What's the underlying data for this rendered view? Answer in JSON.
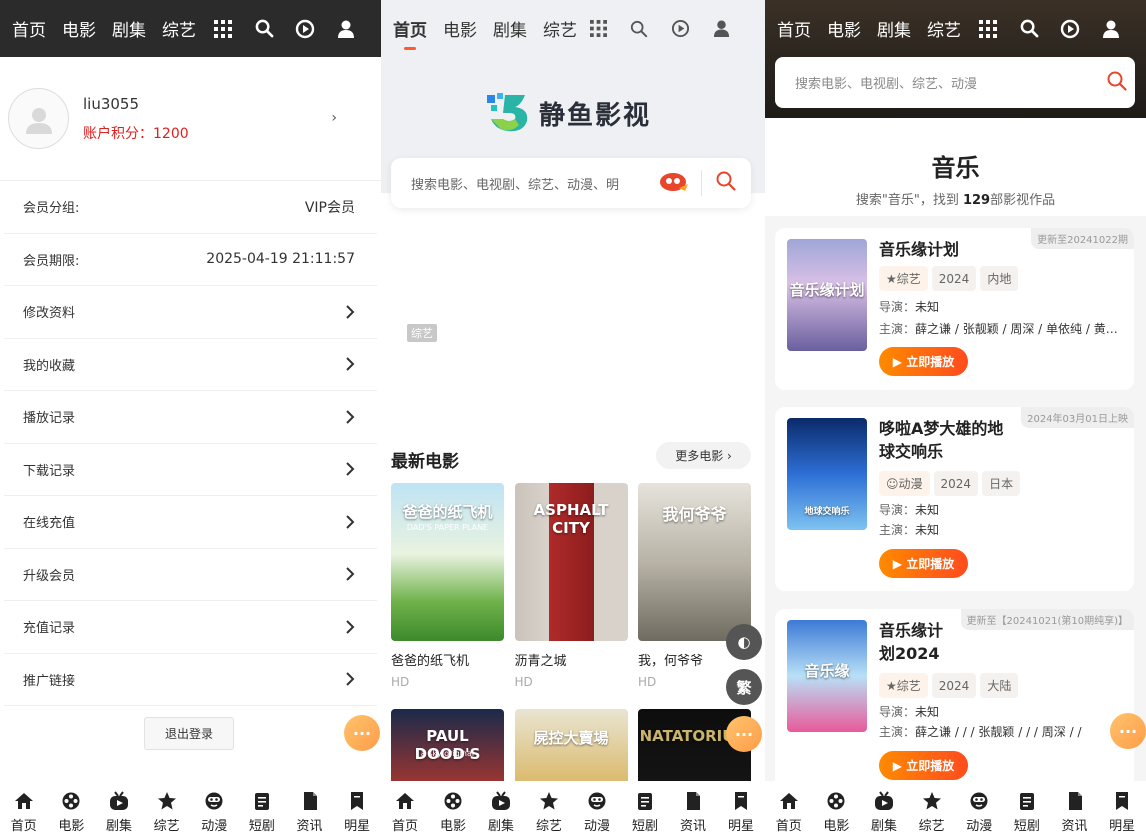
{
  "nav": {
    "home": "首页",
    "movie": "电影",
    "series": "剧集",
    "variety": "综艺"
  },
  "bottom_nav": [
    {
      "label": "首页",
      "icon": "home-icon"
    },
    {
      "label": "电影",
      "icon": "film-reel-icon"
    },
    {
      "label": "剧集",
      "icon": "tv-icon"
    },
    {
      "label": "综艺",
      "icon": "star-icon"
    },
    {
      "label": "动漫",
      "icon": "cartoon-face-icon"
    },
    {
      "label": "短剧",
      "icon": "short-drama-icon"
    },
    {
      "label": "资讯",
      "icon": "news-icon"
    },
    {
      "label": "明星",
      "icon": "star-bookmark-icon"
    }
  ],
  "user_panel": {
    "username": "liu3055",
    "points": "账户积分：1200",
    "rows": [
      {
        "label": "会员分组:",
        "value": "VIP会员"
      },
      {
        "label": "会员期限:",
        "value": "2025-04-19 21:11:57"
      },
      {
        "label": "修改资料",
        "value": ""
      },
      {
        "label": "我的收藏",
        "value": ""
      },
      {
        "label": "播放记录",
        "value": ""
      },
      {
        "label": "下载记录",
        "value": ""
      },
      {
        "label": "在线充值",
        "value": ""
      },
      {
        "label": "升级会员",
        "value": ""
      },
      {
        "label": "充值记录",
        "value": ""
      },
      {
        "label": "推广链接",
        "value": ""
      }
    ],
    "logout": "退出登录",
    "more_fab": "···"
  },
  "home_panel": {
    "logo_text": "静鱼影视",
    "search_placeholder": "搜索电影、电视剧、综艺、动漫、明",
    "banner_tag": "综艺",
    "section_title": "最新电影",
    "more_label": "更多电影 ›",
    "theme_fab": "◐",
    "lang_fab": "繁",
    "more_fab": "···",
    "movies": [
      {
        "title": "爸爸的纸飞机",
        "quality": "HD",
        "poster_text": "爸爸的纸飞机",
        "poster_sub": "DAD'S PAPER PLANE"
      },
      {
        "title": "沥青之城",
        "quality": "HD",
        "poster_text": "ASPHALT CITY",
        "poster_sub": ""
      },
      {
        "title": "我，何爷爷",
        "quality": "HD",
        "poster_text": "我何爷爷",
        "poster_sub": ""
      },
      {
        "title": "",
        "quality": "",
        "poster_text": "PAUL DOOD'S",
        "poster_sub": "a sky original"
      },
      {
        "title": "",
        "quality": "",
        "poster_text": "屍控大賣場",
        "poster_sub": ""
      },
      {
        "title": "",
        "quality": "",
        "poster_text": "NATATORIUM",
        "poster_sub": ""
      }
    ]
  },
  "search_panel": {
    "search_placeholder": "搜索电影、电视剧、综艺、动漫",
    "result_title": "音乐",
    "result_sub_pre": "搜索\"音乐\"，找到 ",
    "result_count": "129",
    "result_sub_post": "部影视作品",
    "more_fab": "···",
    "results": [
      {
        "badge": "更新至20241022期",
        "title_l1": "音乐缘计划",
        "title_l2": "",
        "tags": [
          "★综艺",
          "2024",
          "内地"
        ],
        "director_label": "导演：",
        "director": "未知",
        "cast_label": "主演：",
        "cast": "薛之谦 / 张靓颖 / 周深 / 单依纯 / 黄…",
        "play": "▶ 立即播放",
        "poster_text": "音乐缘计划"
      },
      {
        "badge": "2024年03月01日上映",
        "title_l1": "哆啦A梦大雄的地",
        "title_l2": "球交响乐",
        "tags": [
          "☺动漫",
          "2024",
          "日本"
        ],
        "director_label": "导演：",
        "director": "未知",
        "cast_label": "主演：",
        "cast": "未知",
        "play": "▶ 立即播放",
        "poster_text": "地球交响乐"
      },
      {
        "badge": "更新至【20241021(第10期纯享)】",
        "title_l1": "音乐缘计",
        "title_l2": "划2024",
        "tags": [
          "★综艺",
          "2024",
          "大陆"
        ],
        "director_label": "导演：",
        "director": "未知",
        "cast_label": "主演：",
        "cast": "薛之谦 /  /  / 张靓颖 /  /  / 周深 /  / ",
        "play": "▶ 立即播放",
        "poster_text": "音乐缘"
      }
    ]
  }
}
